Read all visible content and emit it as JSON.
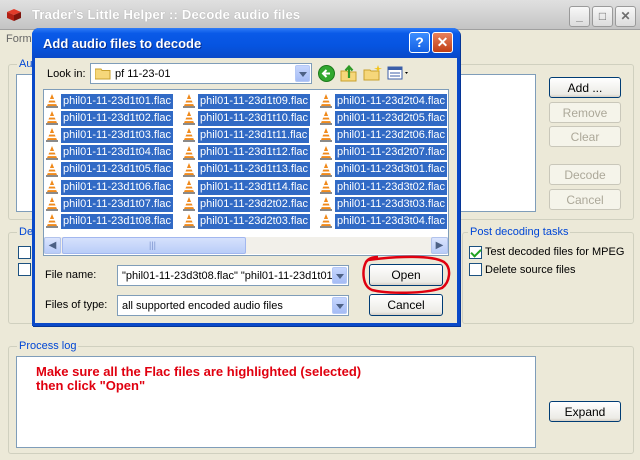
{
  "main": {
    "title": "Trader's Little Helper :: Decode audio files",
    "menu_first": "Form",
    "audio_group_label": "Au",
    "decode_group_label": "De",
    "post_group_label": "Post decoding tasks",
    "process_log_label": "Process log",
    "buttons": {
      "add": "Add ...",
      "remove": "Remove",
      "clear": "Clear",
      "decode": "Decode",
      "cancel": "Cancel",
      "expand": "Expand"
    },
    "post_tasks": [
      {
        "label": "Test decoded files for MPEG",
        "checked": true
      },
      {
        "label": "Delete source files",
        "checked": false
      }
    ],
    "annotation_line1": "Make sure all the Flac files are highlighted (selected)",
    "annotation_line2": "then click \"Open\""
  },
  "dialog": {
    "title": "Add audio files to decode",
    "look_in_label": "Look in:",
    "look_in_value": "pf 11-23-01",
    "file_name_label": "File name:",
    "file_name_value": "\"phil01-11-23d3t08.flac\" \"phil01-11-23d1t01.",
    "files_of_type_label": "Files of type:",
    "files_of_type_value": "all supported encoded audio files",
    "open_label": "Open",
    "cancel_label": "Cancel",
    "files": [
      [
        "phil01-11-23d1t01.flac",
        "phil01-11-23d1t02.flac",
        "phil01-11-23d1t03.flac",
        "phil01-11-23d1t04.flac",
        "phil01-11-23d1t05.flac",
        "phil01-11-23d1t06.flac",
        "phil01-11-23d1t07.flac",
        "phil01-11-23d1t08.flac"
      ],
      [
        "phil01-11-23d1t09.flac",
        "phil01-11-23d1t10.flac",
        "phil01-11-23d1t11.flac",
        "phil01-11-23d1t12.flac",
        "phil01-11-23d1t13.flac",
        "phil01-11-23d1t14.flac",
        "phil01-11-23d2t02.flac",
        "phil01-11-23d2t03.flac"
      ],
      [
        "phil01-11-23d2t04.flac",
        "phil01-11-23d2t05.flac",
        "phil01-11-23d2t06.flac",
        "phil01-11-23d2t07.flac",
        "phil01-11-23d3t01.flac",
        "phil01-11-23d3t02.flac",
        "phil01-11-23d3t03.flac",
        "phil01-11-23d3t04.flac"
      ]
    ]
  },
  "colors": {
    "selection": "#316ac5",
    "annotation": "#e0000f",
    "dialog_titlebar": "#0654e0",
    "xp_face": "#ece9d8"
  },
  "icons": {
    "app": "app-cube-icon",
    "file": "vlc-cone-icon",
    "folder": "folder-icon",
    "back": "back-arrow-icon",
    "up": "up-folder-icon",
    "new_folder": "new-folder-icon",
    "views": "views-menu-icon"
  }
}
